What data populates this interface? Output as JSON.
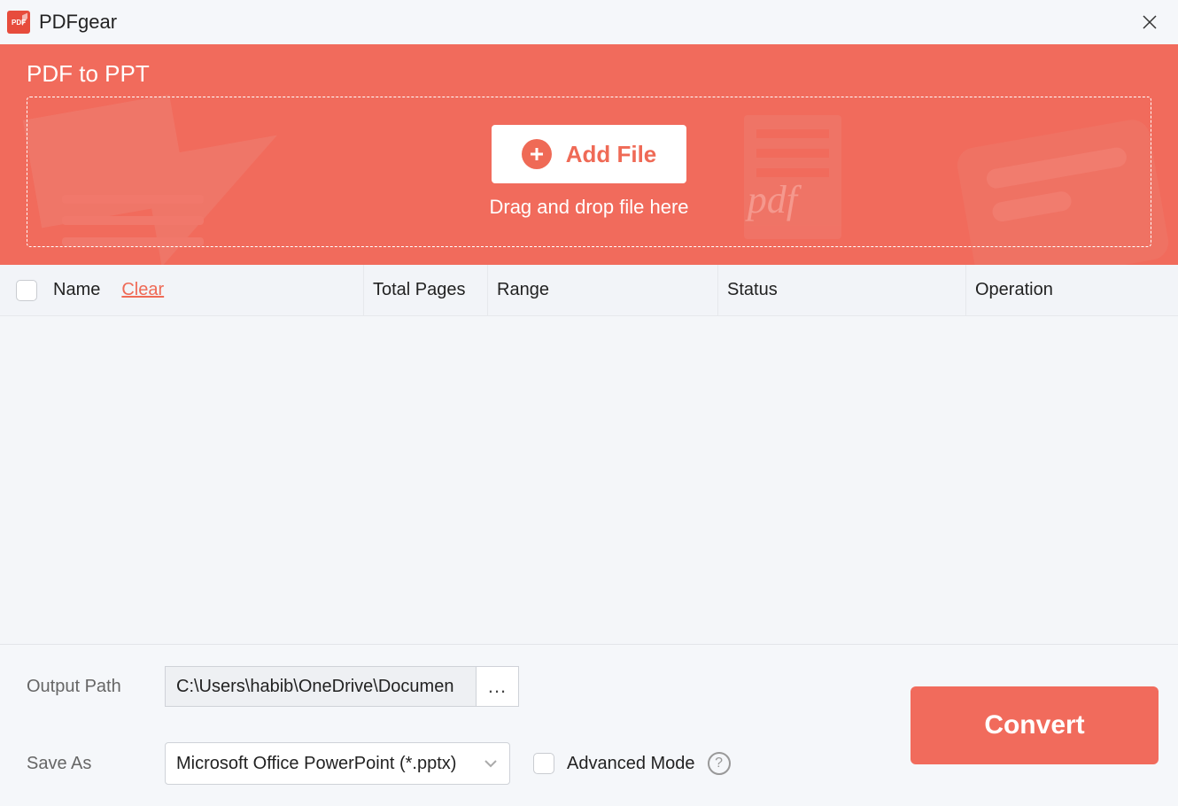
{
  "app": {
    "name": "PDFgear"
  },
  "hero": {
    "title": "PDF to PPT",
    "add_file_label": "Add File",
    "drop_hint": "Drag and drop file here"
  },
  "table": {
    "headers": {
      "name": "Name",
      "clear": "Clear",
      "total_pages": "Total Pages",
      "range": "Range",
      "status": "Status",
      "operation": "Operation"
    },
    "rows": []
  },
  "footer": {
    "output_path_label": "Output Path",
    "output_path_value": "C:\\Users\\habib\\OneDrive\\Documen",
    "browse_label": "...",
    "save_as_label": "Save As",
    "save_as_value": "Microsoft Office PowerPoint (*.pptx)",
    "advanced_mode_label": "Advanced Mode",
    "convert_label": "Convert"
  }
}
